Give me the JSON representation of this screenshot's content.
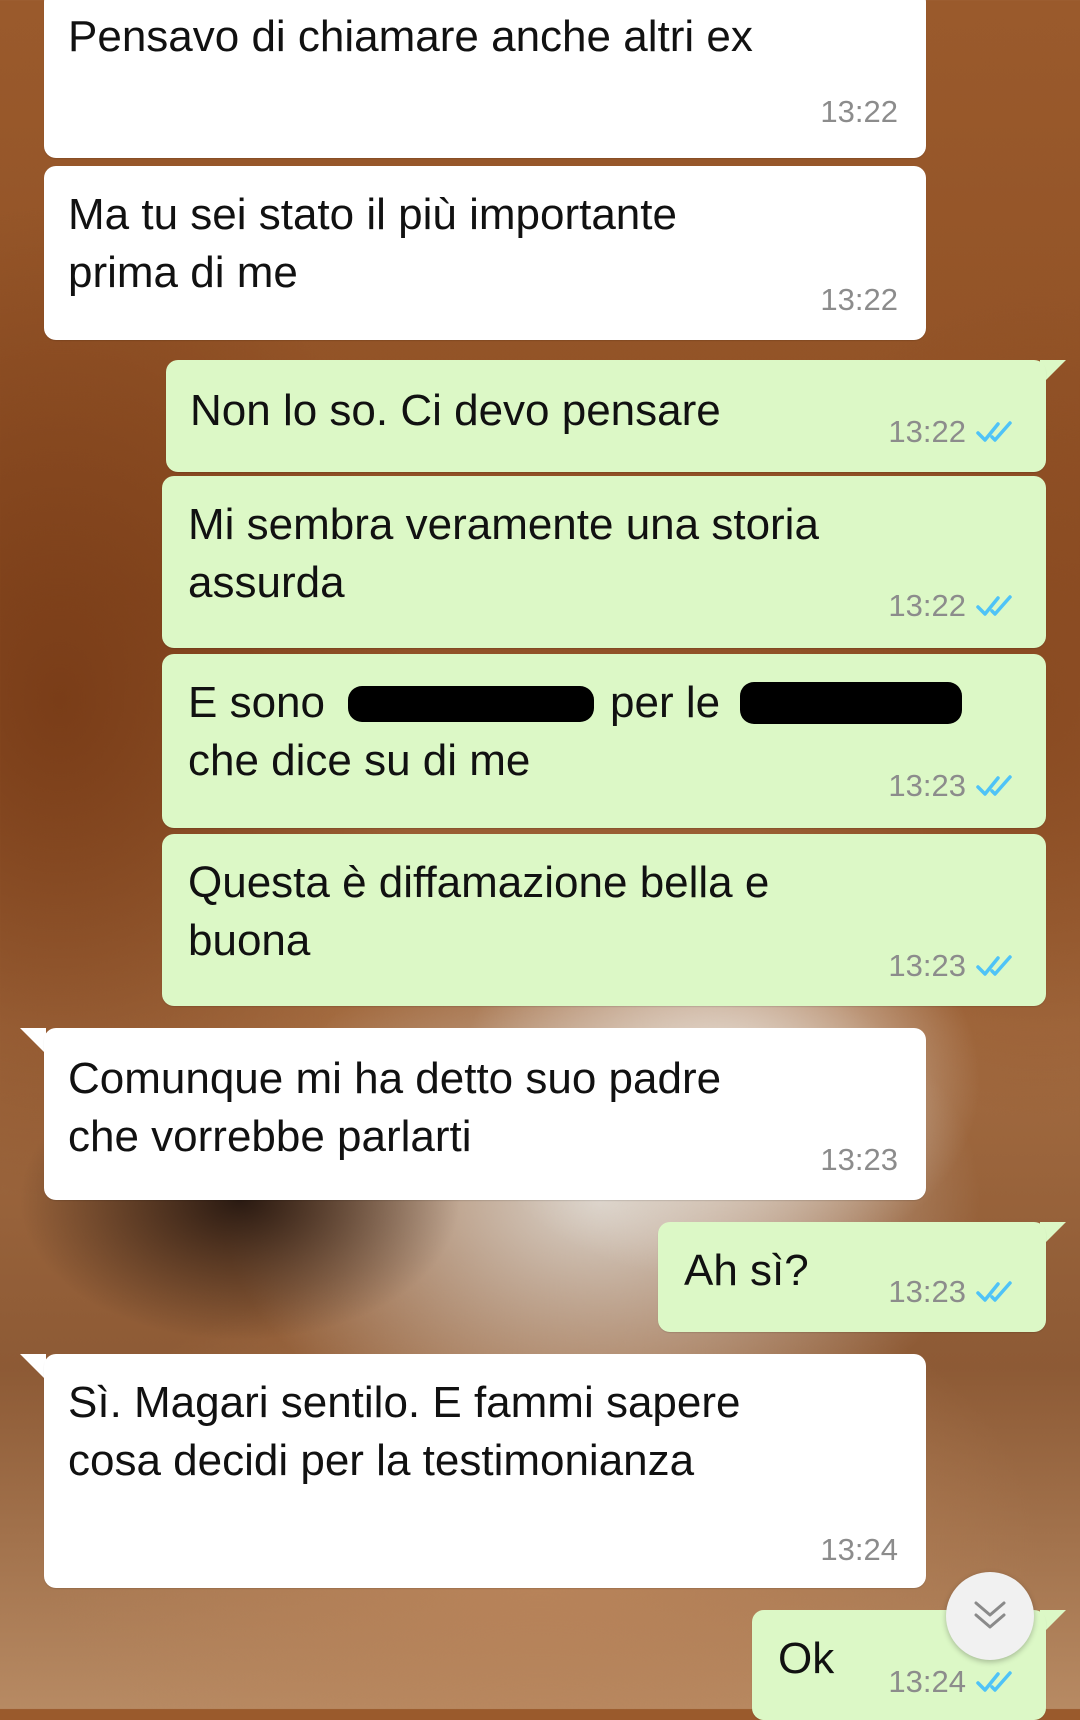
{
  "conversation": {
    "messages": [
      {
        "direction": "incoming",
        "text": "Pensavo di chiamare anche altri ex",
        "time": "13:22"
      },
      {
        "direction": "incoming",
        "text": "Ma tu sei stato il più importante\nprima di me",
        "time": "13:22"
      },
      {
        "direction": "outgoing",
        "text": "Non lo so. Ci devo pensare",
        "time": "13:22",
        "status": "read"
      },
      {
        "direction": "outgoing",
        "text": "Mi sembra veramente una storia\nassurda",
        "time": "13:22",
        "status": "read"
      },
      {
        "direction": "outgoing",
        "text_part1": "E sono",
        "text_part2": "per le",
        "text_part3": "che dice su di me",
        "time": "13:23",
        "status": "read"
      },
      {
        "direction": "outgoing",
        "text": "Questa è diffamazione bella e\nbuona",
        "time": "13:23",
        "status": "read"
      },
      {
        "direction": "incoming",
        "text": "Comunque mi ha detto suo padre\nche vorrebbe parlarti",
        "time": "13:23"
      },
      {
        "direction": "outgoing",
        "text": "Ah sì?",
        "time": "13:23",
        "status": "read"
      },
      {
        "direction": "incoming",
        "text": "Sì. Magari sentilo. E fammi sapere\ncosa decidi per la testimonianza",
        "time": "13:24"
      },
      {
        "direction": "outgoing",
        "text": "Ok",
        "time": "13:24",
        "status": "read"
      }
    ]
  },
  "colors": {
    "incoming_bubble": "#ffffff",
    "outgoing_bubble": "#dcf8c6",
    "read_ticks": "#4fc3f7",
    "timestamp": "#8c8c8c"
  },
  "icons": {
    "read_status": "double-check-icon",
    "scroll_down": "double-chevron-down-icon"
  }
}
